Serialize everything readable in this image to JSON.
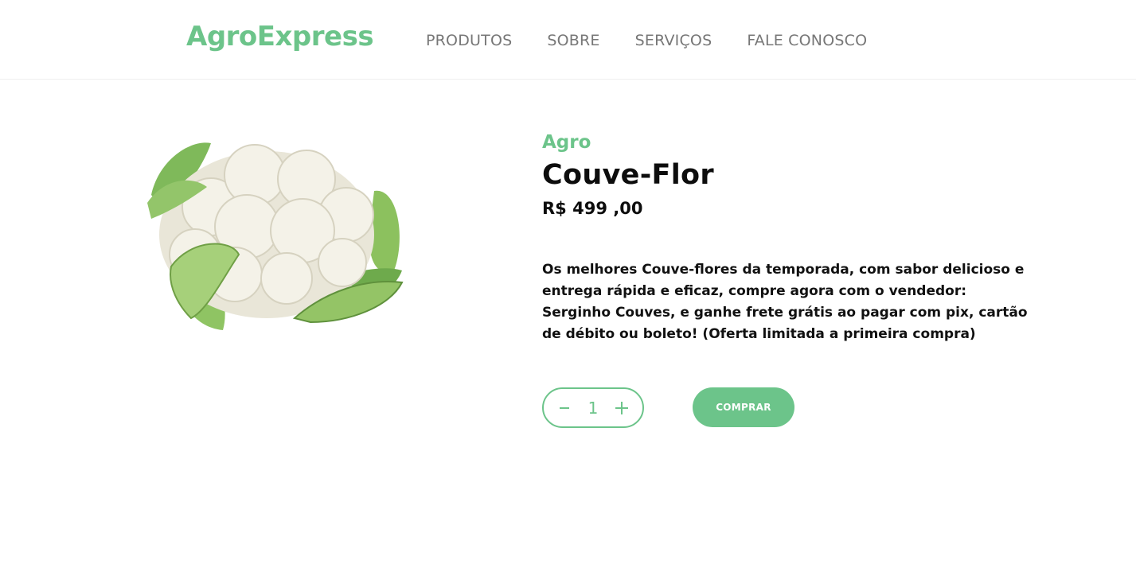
{
  "brand": {
    "name": "AgroExpress",
    "color": "#6cc48a"
  },
  "nav": {
    "items": [
      "PRODUTOS",
      "SOBRE",
      "SERVIÇOS",
      "FALE CONOSCO"
    ]
  },
  "product": {
    "image_icon": "cauliflower-image",
    "category": "Agro",
    "name": "Couve-Flor",
    "price": "R$ 499 ,00",
    "description": "Os melhores Couve-flores da temporada, com sabor delicioso e entrega rápida e eficaz, compre agora com o vendedor: Serginho Couves, e ganhe frete grátis ao pagar com pix, cartão de débito ou boleto! (Oferta limitada a primeira compra)"
  },
  "quantity": {
    "value": "1",
    "decrement_icon": "minus-icon",
    "increment_icon": "plus-icon"
  },
  "actions": {
    "buy_label": "COMPRAR"
  }
}
